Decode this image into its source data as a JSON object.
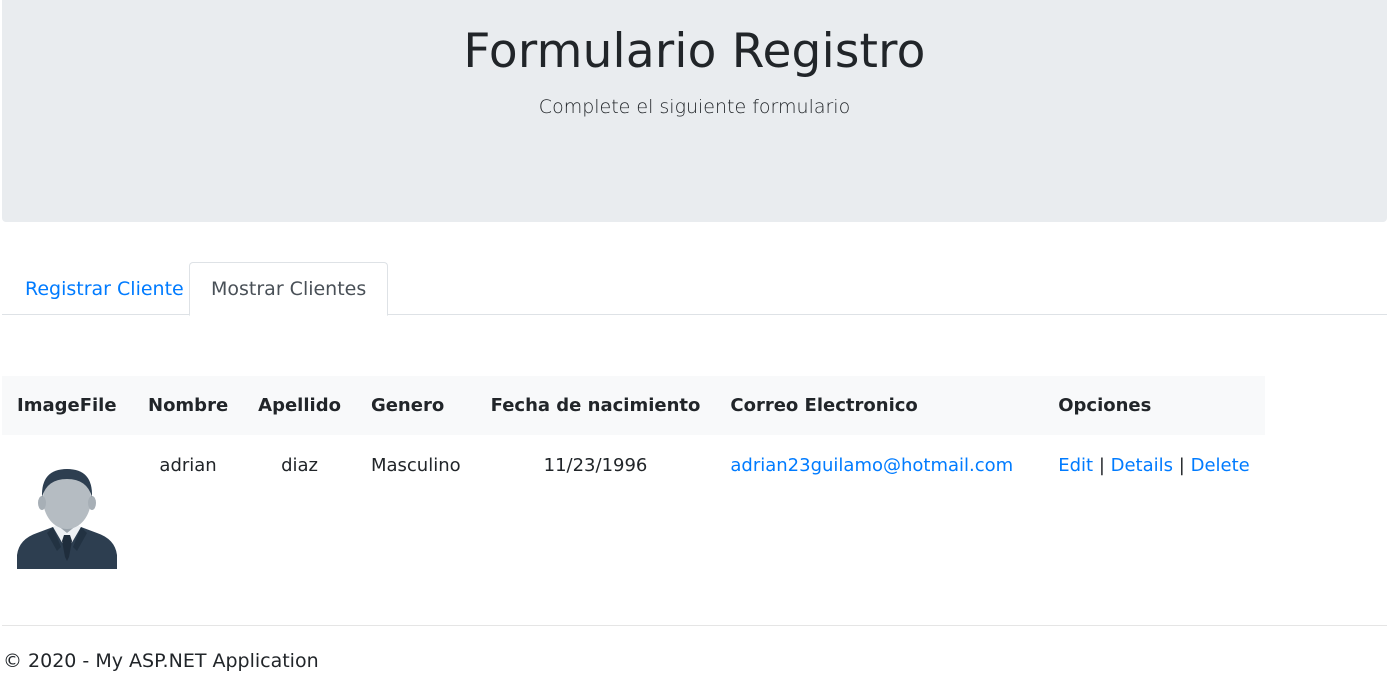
{
  "header": {
    "title": "Formulario Registro",
    "subtitle": "Complete el siguiente formulario"
  },
  "tabs": [
    {
      "label": "Registrar Cliente",
      "active": false
    },
    {
      "label": "Mostrar Clientes",
      "active": true
    }
  ],
  "table": {
    "columns": [
      "ImageFile",
      "Nombre",
      "Apellido",
      "Genero",
      "Fecha de nacimiento",
      "Correo Electronico",
      "Opciones"
    ],
    "rows": [
      {
        "image_icon": "person-avatar-icon",
        "nombre": "adrian",
        "apellido": "diaz",
        "genero": "Masculino",
        "fecha": "11/23/1996",
        "correo": "adrian23guilamo@hotmail.com",
        "options": {
          "edit": "Edit",
          "details": "Details",
          "delete": "Delete",
          "separator": "|"
        }
      }
    ]
  },
  "footer": {
    "text": "© 2020 - My ASP.NET Application"
  },
  "colors": {
    "link": "#007bff",
    "jumbotron_bg": "#e9ecef",
    "table_header_bg": "#f8f9fa"
  }
}
